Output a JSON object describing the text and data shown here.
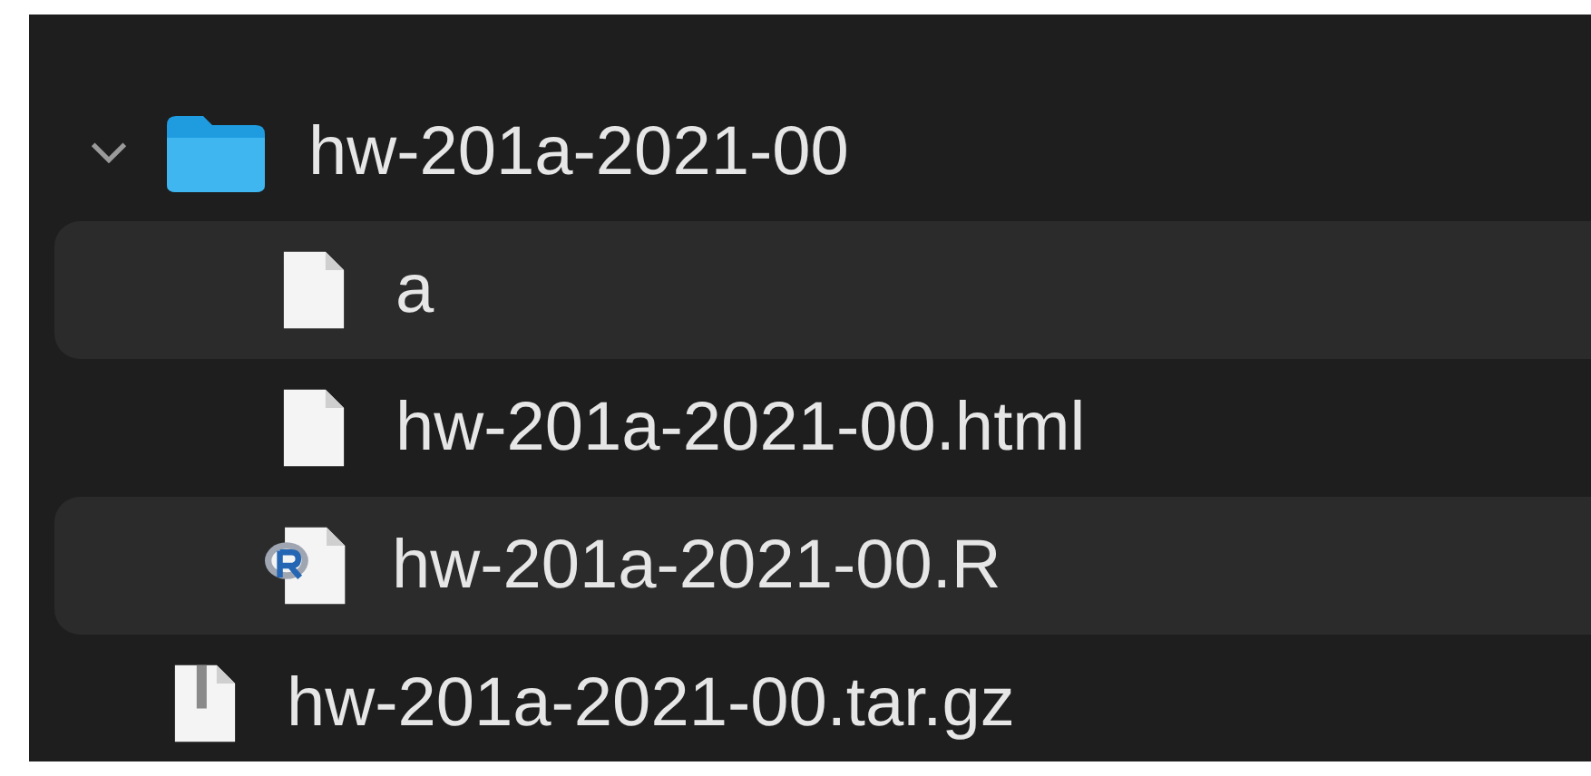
{
  "items": [
    {
      "kind": "folder",
      "name": "hw-201a-2021-00",
      "expanded": true,
      "children": [
        {
          "kind": "document",
          "name": "a"
        },
        {
          "kind": "document",
          "name": "hw-201a-2021-00.html"
        },
        {
          "kind": "r-script",
          "name": "hw-201a-2021-00.R"
        }
      ]
    },
    {
      "kind": "archive",
      "name": "hw-201a-2021-00.tar.gz"
    }
  ]
}
